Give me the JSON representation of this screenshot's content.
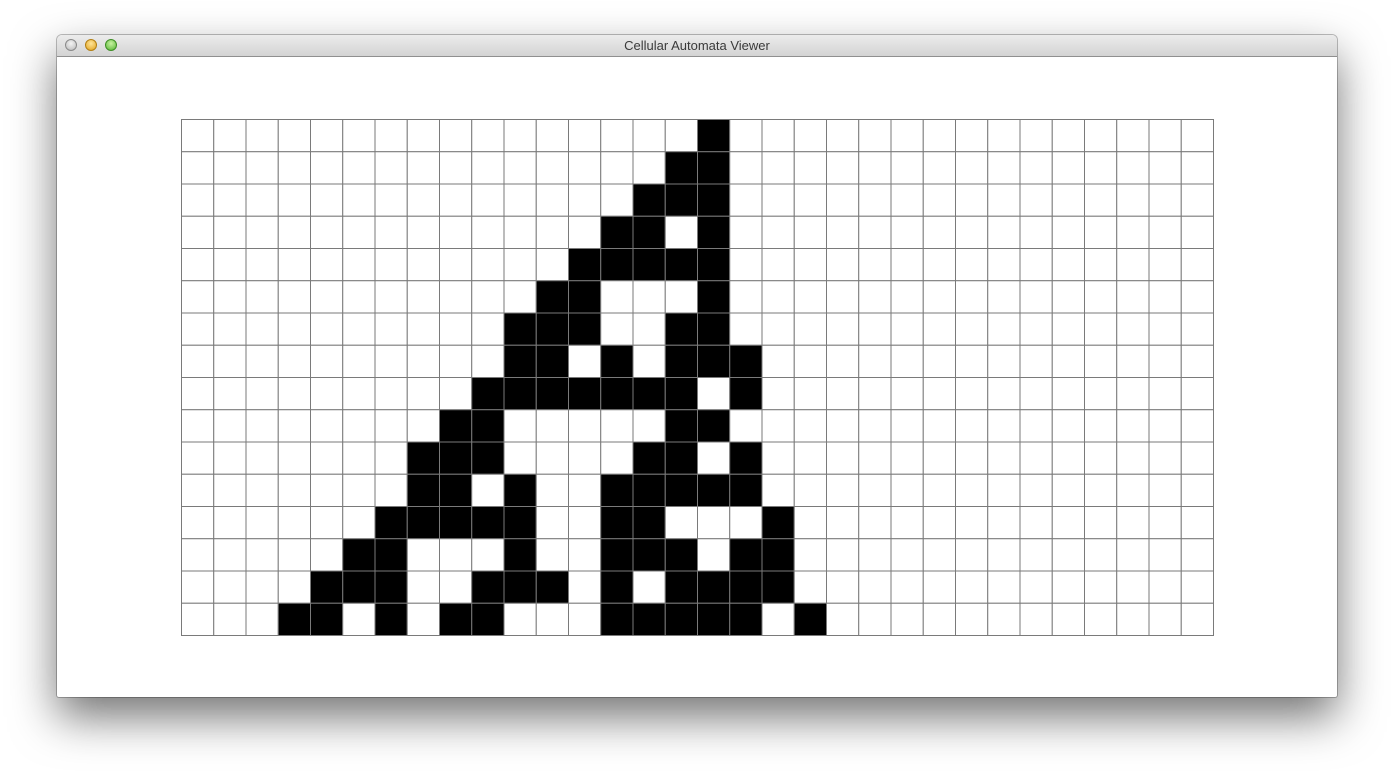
{
  "window": {
    "title": "Cellular Automata Viewer"
  },
  "automaton": {
    "columns": 32,
    "rows": 16,
    "alive_color": "#000000",
    "dead_color": "#ffffff",
    "grid_line_color": "#7a7a7a",
    "cells": [
      "0000000000000000100000000000000",
      "0000000000000001100000000000000",
      "0000000000000011100000000000000",
      "0000000000000110100000000000000",
      "0000000000001111100000000000000",
      "0000000000011000100000000000000",
      "0000000000111001100000000000000",
      "0000000000110101110000000000000",
      "0000000001111111010000000000000",
      "0000000011000001100000000000000",
      "0000000111000011010000000000000",
      "0000000110100111110000000000000",
      "0000001111100110001000000000000",
      "0000011000100111011000000000000",
      "0000111001110101111000000000000",
      "0001101011000111110100000000000"
    ]
  }
}
